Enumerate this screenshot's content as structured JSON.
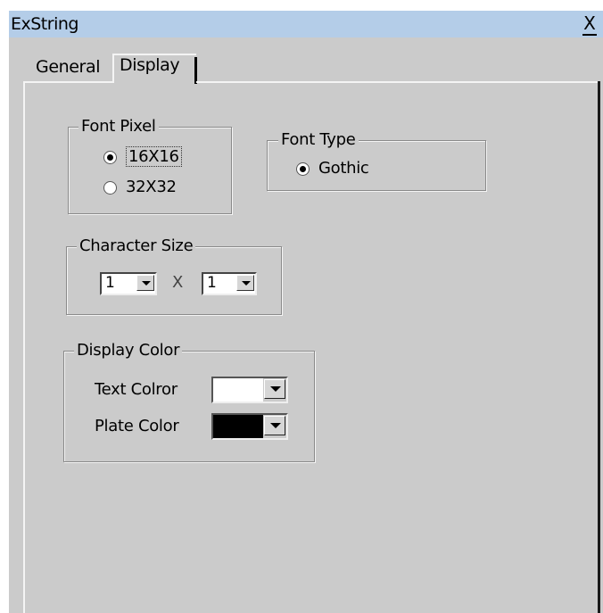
{
  "window": {
    "title": "ExString",
    "close_label": "X"
  },
  "tabs": [
    {
      "label": "General",
      "active": false
    },
    {
      "label": "Display",
      "active": true
    }
  ],
  "font_pixel": {
    "legend": "Font Pixel",
    "options": [
      {
        "label": "16X16",
        "checked": true
      },
      {
        "label": "32X32",
        "checked": false
      }
    ]
  },
  "font_type": {
    "legend": "Font Type",
    "options": [
      {
        "label": "Gothic",
        "checked": true
      }
    ]
  },
  "character_size": {
    "legend": "Character Size",
    "width_value": "1",
    "separator": "X",
    "height_value": "1"
  },
  "display_color": {
    "legend": "Display Color",
    "text_color_label": "Text Colror",
    "text_color_value": "#ffffff",
    "plate_color_label": "Plate Color",
    "plate_color_value": "#000000"
  }
}
